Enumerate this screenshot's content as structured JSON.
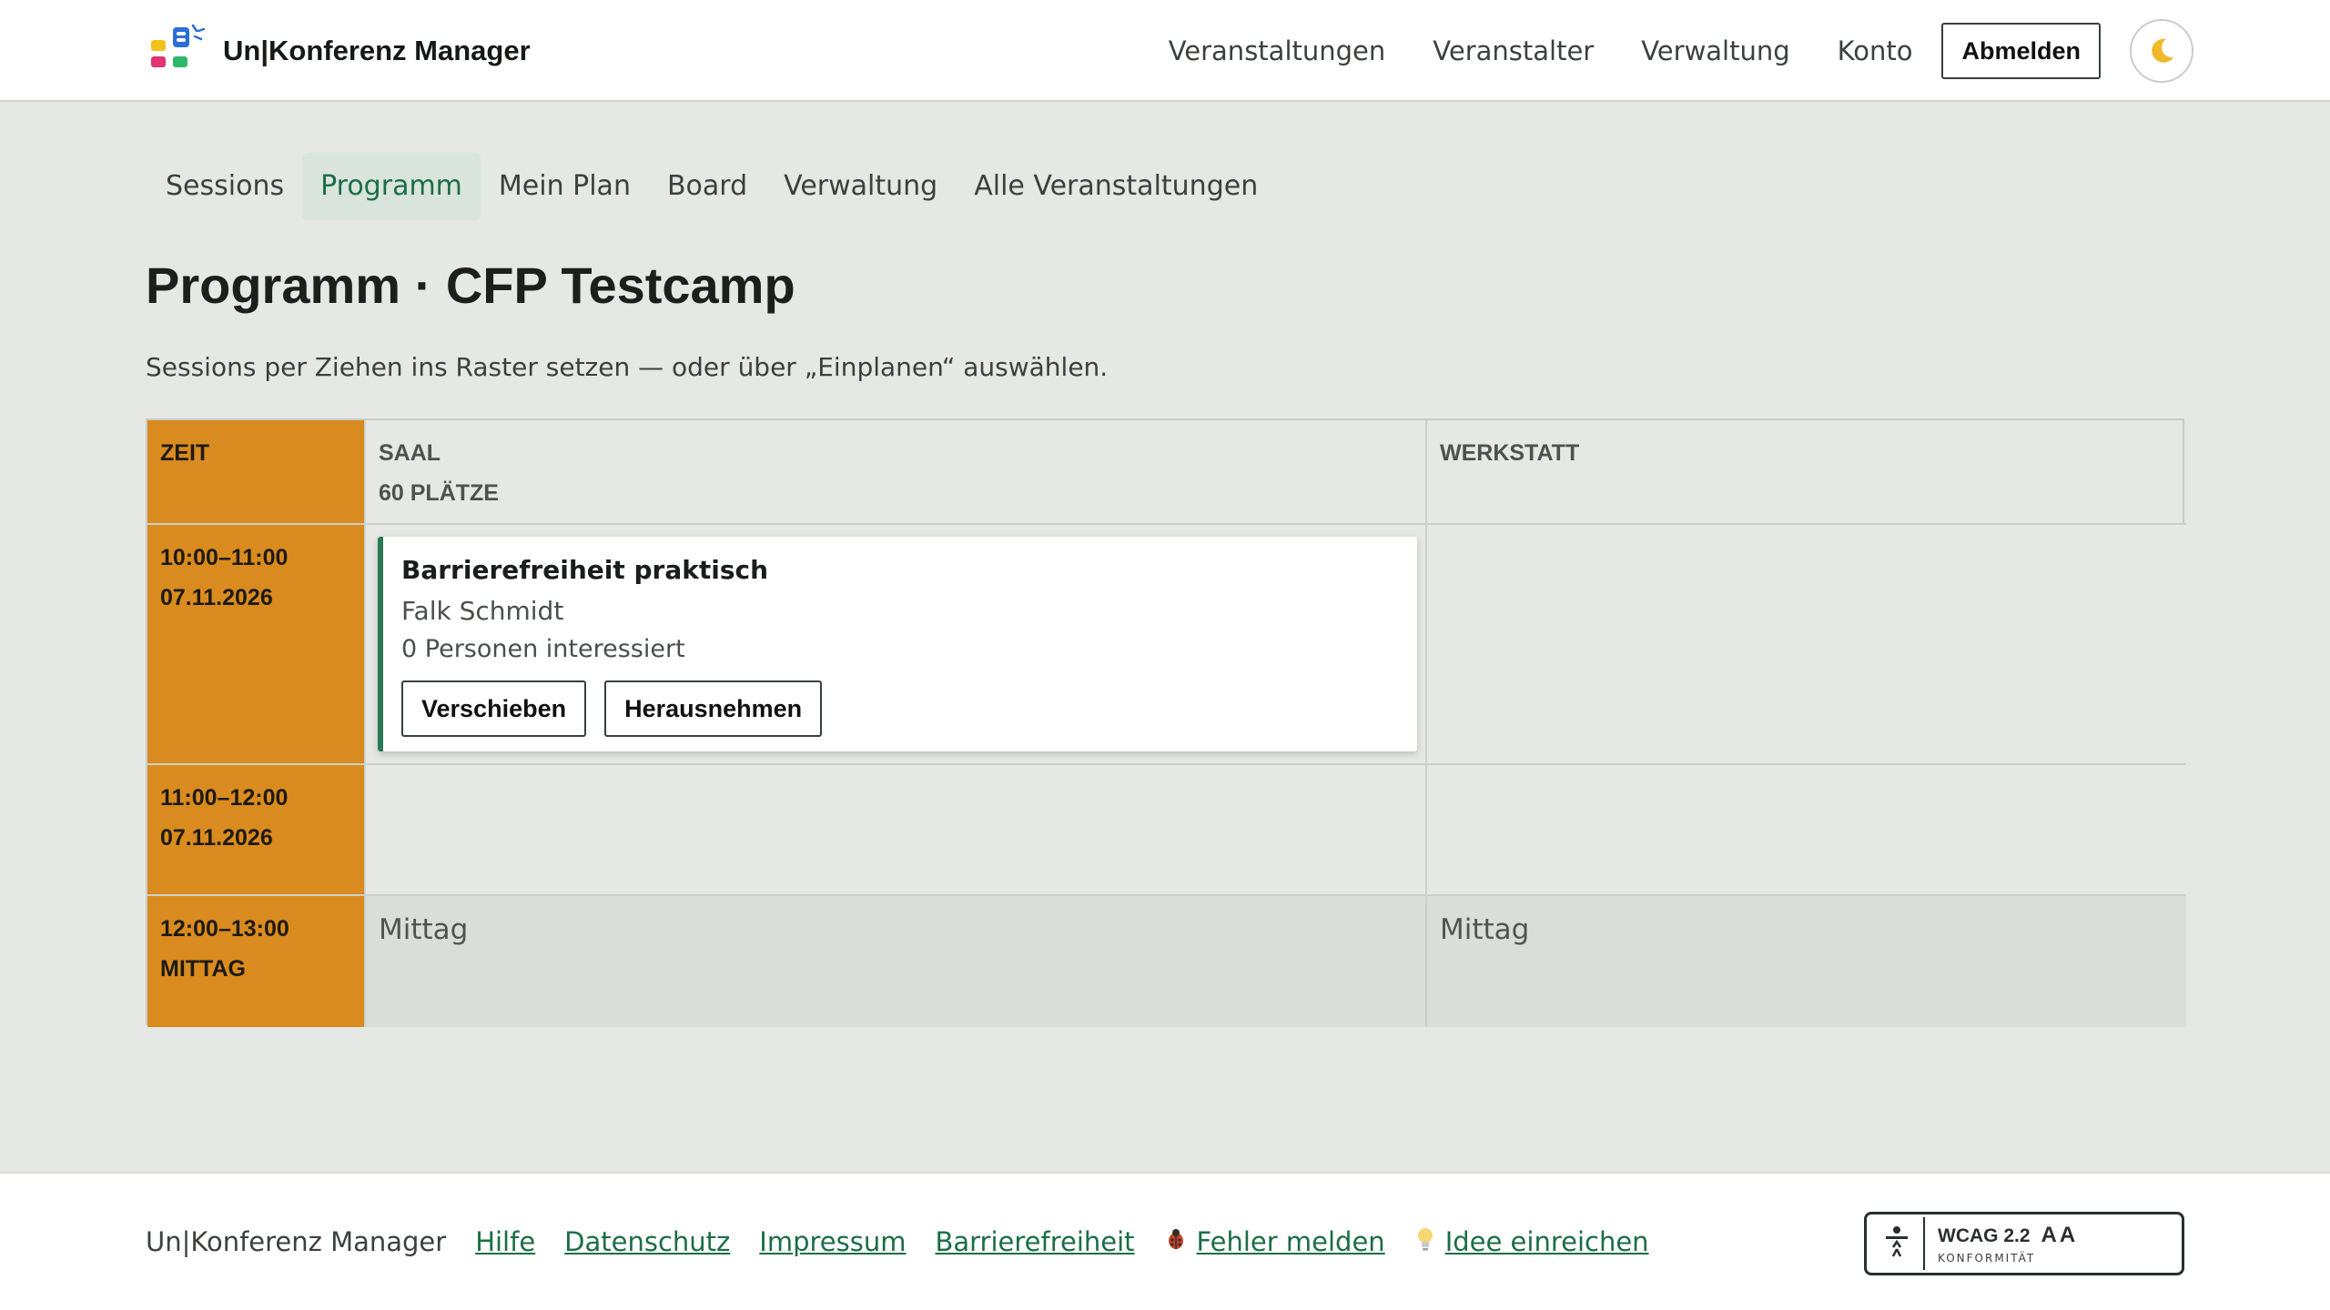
{
  "header": {
    "brand": "Un|Konferenz Manager",
    "nav": [
      "Veranstaltungen",
      "Veranstalter",
      "Verwaltung",
      "Konto"
    ],
    "logout_label": "Abmelden",
    "theme_icon": "moon-icon"
  },
  "subnav": {
    "tabs": [
      "Sessions",
      "Programm",
      "Mein Plan",
      "Board",
      "Verwaltung",
      "Alle Veranstaltungen"
    ],
    "active": "Programm"
  },
  "page": {
    "title": "Programm · CFP Testcamp",
    "hint": "Sessions per Ziehen ins Raster setzen — oder über „Einplanen“ auswählen."
  },
  "grid": {
    "time_header": "ZEIT",
    "rooms": [
      {
        "name": "SAAL",
        "capacity": "60 PLÄTZE"
      },
      {
        "name": "WERKSTATT",
        "capacity": ""
      }
    ],
    "slots": [
      {
        "time": "10:00–11:00",
        "date": "07.11.2026"
      },
      {
        "time": "11:00–12:00",
        "date": "07.11.2026"
      },
      {
        "time": "12:00–13:00",
        "date": "MITTAG",
        "room_labels": [
          "Mittag",
          "Mittag"
        ]
      }
    ],
    "session": {
      "title": "Barrierefreiheit praktisch",
      "speaker": "Falk Schmidt",
      "interest": "0 Personen interessiert",
      "move_label": "Verschieben",
      "remove_label": "Herausnehmen"
    }
  },
  "footer": {
    "brand": "Un|Konferenz Manager",
    "links": [
      "Hilfe",
      "Datenschutz",
      "Impressum",
      "Barrierefreiheit"
    ],
    "bug_label": "Fehler melden",
    "idea_label": "Idee einreichen",
    "badge_title": "WCAG 2.2",
    "badge_level": "AA",
    "badge_sub": "KONFORMITÄT"
  },
  "colors": {
    "accent_green": "#1b6e46",
    "time_column": "#d98b1f",
    "background": "#e5e8e5"
  }
}
